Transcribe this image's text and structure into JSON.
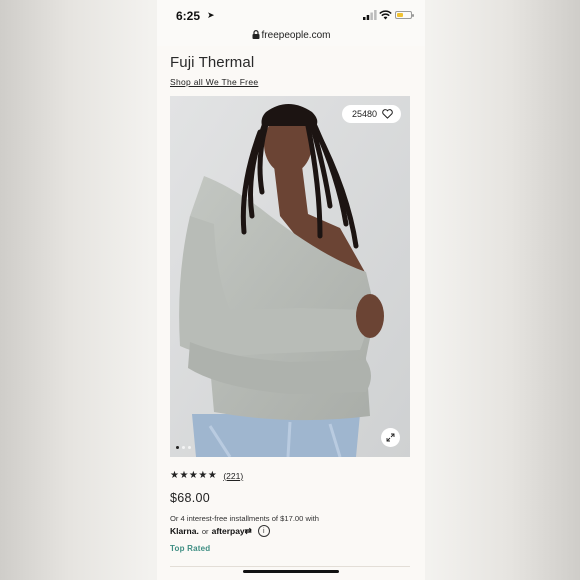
{
  "status_bar": {
    "time": "6:25",
    "location_glyph": "➤"
  },
  "url_bar": {
    "domain": "freepeople.com"
  },
  "product": {
    "title": "Fuji Thermal",
    "shop_link": "Shop all We The Free",
    "like_count": "25480",
    "rating_stars": "★★★★★",
    "rating_value": 4.5,
    "review_count": "(221)",
    "price": "$68.00",
    "installments_text": "Or 4 interest-free installments of $17.00 with",
    "klarna": "Klarna.",
    "or_text": "or",
    "afterpay": "afterpay⇄",
    "info_glyph": "i",
    "badge": "Top Rated"
  },
  "gallery": {
    "image_count": 3,
    "active_index": 0
  },
  "colors": {
    "accent_green": "#3e8e83",
    "battery": "#f1c232",
    "background": "#fbf9f6"
  }
}
